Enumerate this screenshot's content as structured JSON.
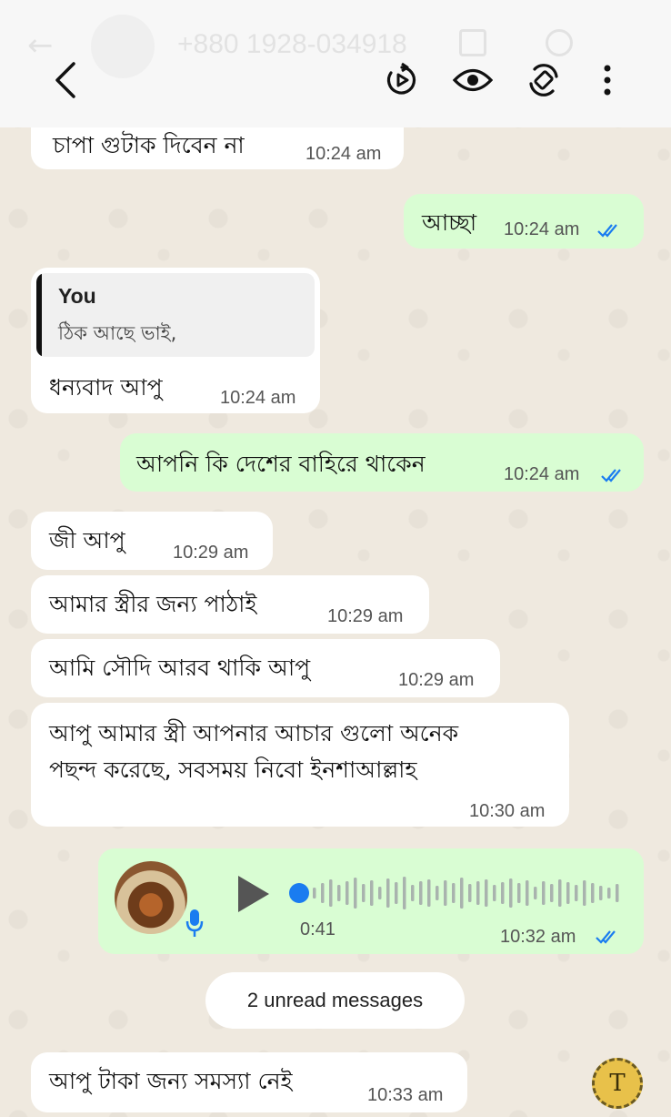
{
  "ghost_header": {
    "number": "+880 1928-034918"
  },
  "toolbar": {
    "icons": [
      "back-icon",
      "gif-icon",
      "eye-icon",
      "rotate-icon",
      "more-icon"
    ]
  },
  "messages": [
    {
      "text": "চাপা গুটাক দিবেন না",
      "time": "10:24 am"
    },
    {
      "text": "আচ্ছা",
      "time": "10:24 am"
    },
    {
      "quote_author": "You",
      "quote_text": "ঠিক আছে ভাই,",
      "text": "ধন্যবাদ আপু",
      "time": "10:24 am"
    },
    {
      "text": "আপনি কি দেশের বাহিরে থাকেন",
      "time": "10:24 am"
    },
    {
      "text": "জী আপু",
      "time": "10:29 am"
    },
    {
      "text": "আমার স্ত্রীর জন্য পাঠাই",
      "time": "10:29 am"
    },
    {
      "text": "আমি সৌদি আরব থাকি আপু",
      "time": "10:29 am"
    },
    {
      "line1": "আপু আমার স্ত্রী আপনার আচার গুলো অনেক",
      "line2": "পছন্দ করেছে, সবসময় নিবো ইনশাআল্লাহ",
      "time": "10:30 am"
    },
    {
      "duration": "0:41",
      "time": "10:32 am"
    },
    {
      "text": "আপু টাকা জন্য সমস্যা নেই",
      "time": "10:33 am"
    }
  ],
  "unread_label": "2 unread messages",
  "fab_label": "T",
  "colors": {
    "outgoing": "#d9fdd3",
    "incoming": "#ffffff",
    "read_ticks": "#1a7cf0"
  }
}
